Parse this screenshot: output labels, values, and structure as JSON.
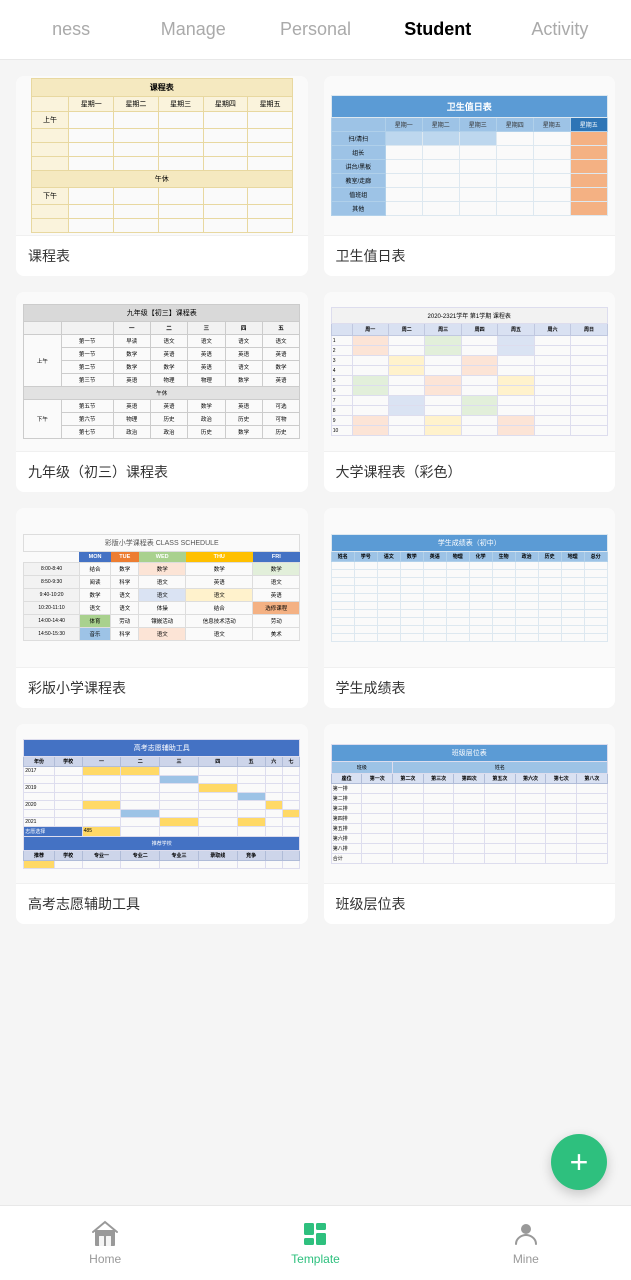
{
  "nav": {
    "items": [
      {
        "id": "ness",
        "label": "ness",
        "active": false
      },
      {
        "id": "manage",
        "label": "Manage",
        "active": false
      },
      {
        "id": "personal",
        "label": "Personal",
        "active": false
      },
      {
        "id": "student",
        "label": "Student",
        "active": true
      },
      {
        "id": "activity",
        "label": "Activity",
        "active": false
      }
    ]
  },
  "cards": [
    {
      "id": "card1",
      "label": "课程表"
    },
    {
      "id": "card2",
      "label": "卫生值日表"
    },
    {
      "id": "card3",
      "label": "九年级（初三）课程表"
    },
    {
      "id": "card4",
      "label": "大学课程表（彩色）"
    },
    {
      "id": "card5",
      "label": "彩版小学课程表"
    },
    {
      "id": "card6",
      "label": "学生成绩表"
    },
    {
      "id": "card7",
      "label": "高考志愿辅助工具"
    },
    {
      "id": "card8",
      "label": "班级层位表"
    }
  ],
  "bottomNav": {
    "items": [
      {
        "id": "home",
        "label": "Home",
        "active": false
      },
      {
        "id": "template",
        "label": "Template",
        "active": true
      },
      {
        "id": "mine",
        "label": "Mine",
        "active": false
      }
    ]
  }
}
